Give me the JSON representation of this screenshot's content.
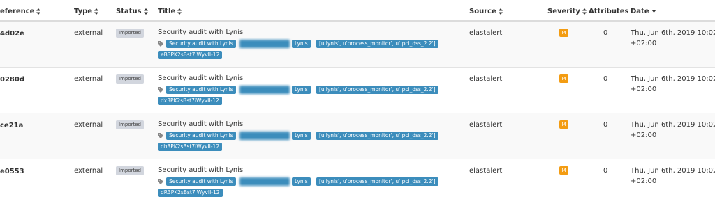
{
  "columns": {
    "reference": "eference",
    "type": "Type",
    "status": "Status",
    "title": "Title",
    "source": "Source",
    "severity": "Severity",
    "attributes": "Attributes",
    "date": "Date"
  },
  "rows": [
    {
      "reference": "4d02e",
      "type": "external",
      "status": "Imported",
      "title": "Security audit with Lynis",
      "tags": [
        "Security audit with Lynis",
        "",
        "Lynis",
        "[u'lynis', u'process_monitor', u' pci_dss_2.2']",
        "eB3PK2sBst7iWyvII-12"
      ],
      "source": "elastalert",
      "severity": "M",
      "attributes": "0",
      "date_line1": "Thu, Jun 6th, 2019 10:02",
      "date_line2": "+02:00"
    },
    {
      "reference": "0280d",
      "type": "external",
      "status": "Imported",
      "title": "Security audit with Lynis",
      "tags": [
        "Security audit with Lynis",
        "",
        "Lynis",
        "[u'lynis', u'process_monitor', u' pci_dss_2.2']",
        "dx3PK2sBst7iWyvII-12"
      ],
      "source": "elastalert",
      "severity": "M",
      "attributes": "0",
      "date_line1": "Thu, Jun 6th, 2019 10:02",
      "date_line2": "+02:00"
    },
    {
      "reference": "ce21a",
      "type": "external",
      "status": "Imported",
      "title": "Security audit with Lynis",
      "tags": [
        "Security audit with Lynis",
        "",
        "Lynis",
        "[u'lynis', u'process_monitor', u' pci_dss_2.2']",
        "dh3PK2sBst7iWyvII-12"
      ],
      "source": "elastalert",
      "severity": "M",
      "attributes": "0",
      "date_line1": "Thu, Jun 6th, 2019 10:02",
      "date_line2": "+02:00"
    },
    {
      "reference": "e0553",
      "type": "external",
      "status": "Imported",
      "title": "Security audit with Lynis",
      "tags": [
        "Security audit with Lynis",
        "",
        "Lynis",
        "[u'lynis', u'process_monitor', u' pci_dss_2.2']",
        "dR3PK2sBst7iWyvII-12"
      ],
      "source": "elastalert",
      "severity": "M",
      "attributes": "0",
      "date_line1": "Thu, Jun 6th, 2019 10:02",
      "date_line2": "+02:00"
    }
  ],
  "colors": {
    "tag_bg": "#3c8dbc",
    "severity_medium": "#f39c12",
    "status_bg": "#d2d6de",
    "row_alt": "#f9f9f9"
  },
  "icons": {
    "sort": "sort-icon",
    "sort_desc": "sort-desc-icon",
    "tag": "tag-icon"
  }
}
